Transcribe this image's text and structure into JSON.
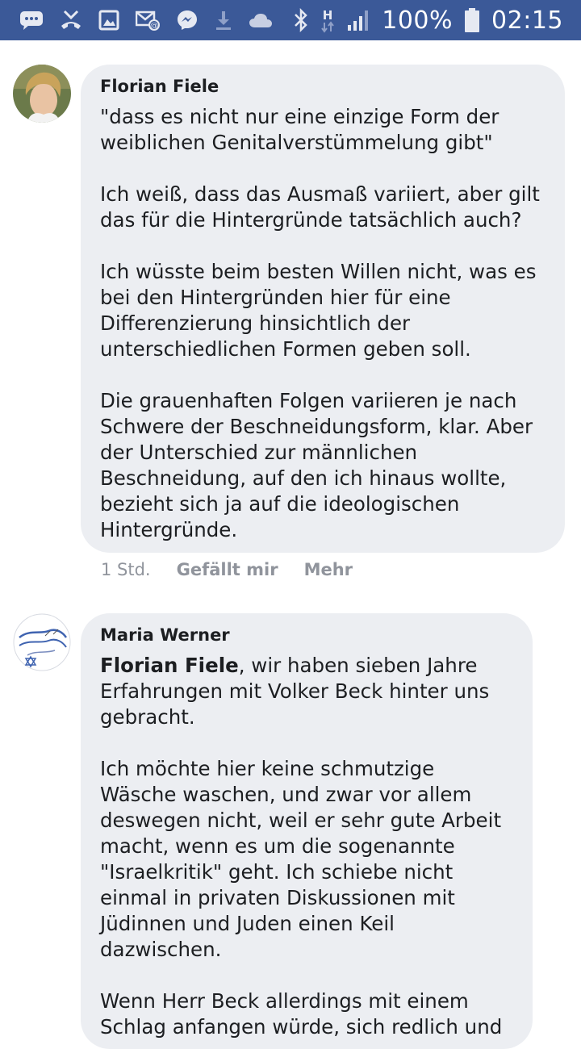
{
  "status_bar": {
    "left_icons": [
      "message-icon",
      "missed-call-icon",
      "image-icon",
      "email-icon",
      "messenger-icon",
      "download-icon",
      "cloud-icon"
    ],
    "right_icons": [
      "bluetooth-icon",
      "network-h-icon",
      "signal-icon",
      "battery-icon"
    ],
    "battery": "100%",
    "time": "02:15"
  },
  "comments": [
    {
      "author": "Florian Fiele",
      "avatar": "profile-photo",
      "paragraphs": [
        "\"dass es nicht nur eine einzige Form der\nweiblichen Genitalverstümmelung gibt\"",
        "Ich weiß, dass das Ausmaß variiert, aber gilt\ndas für die Hintergründe tatsächlich auch?",
        "Ich wüsste beim besten Willen nicht, was es\nbei den Hintergründen hier für eine\nDifferenzierung hinsichtlich der\nunterschiedlichen Formen geben soll.",
        "Die grauenhaften Folgen variieren je nach\nSchwere der Beschneidungsform, klar. Aber\nder Unterschied zur männlichen\nBeschneidung, auf den ich hinaus wollte,\nbezieht sich ja auf die ideologischen\nHintergründe."
      ],
      "time": "1 Std.",
      "like_label": "Gefällt mir",
      "more_label": "Mehr"
    },
    {
      "author": "Maria Werner",
      "avatar": "israel-flag-drawing",
      "mention": "Florian Fiele",
      "first_paragraph_rest": ", wir haben sieben Jahre\nErfahrungen mit Volker Beck hinter uns\ngebracht.",
      "paragraphs": [
        "Ich möchte hier keine schmutzige\nWäsche waschen, und zwar vor allem\ndeswegen nicht, weil er sehr gute Arbeit\nmacht, wenn es um die sogenannte\n\"Israelkritik\" geht. Ich schiebe nicht\neinmal in privaten Diskussionen mit\nJüdinnen und Juden einen Keil\ndazwischen.",
        "Wenn Herr Beck allerdings mit einem\nSchlag anfangen würde, sich redlich und"
      ]
    }
  ]
}
